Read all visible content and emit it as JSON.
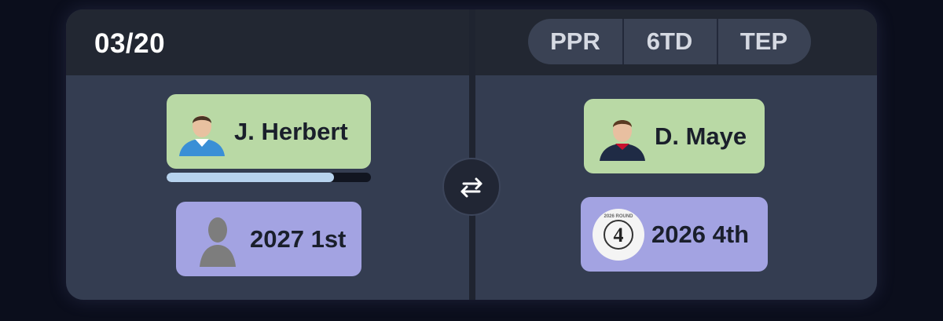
{
  "header": {
    "date": "03/20",
    "tags": [
      "PPR",
      "6TD",
      "TEP"
    ]
  },
  "left_side": {
    "player": {
      "name": "J. Herbert",
      "avatar": "player-photo",
      "progress": 0.82
    },
    "pick": {
      "label": "2027 1st",
      "avatar": "person-silhouette-icon"
    }
  },
  "right_side": {
    "player": {
      "name": "D. Maye",
      "avatar": "player-photo"
    },
    "pick": {
      "label": "2026 4th",
      "avatar": "round-4-badge-icon",
      "badge_number": "4",
      "badge_text": "2026 ROUND"
    }
  },
  "swap_icon": "swap-arrows-icon",
  "colors": {
    "background": "#0b0e1c",
    "card": "#343d51",
    "header": "#222732",
    "player_chip": "#b9d9a5",
    "pick_chip": "#a3a3e2",
    "progress_fill": "#b7d3ee"
  }
}
